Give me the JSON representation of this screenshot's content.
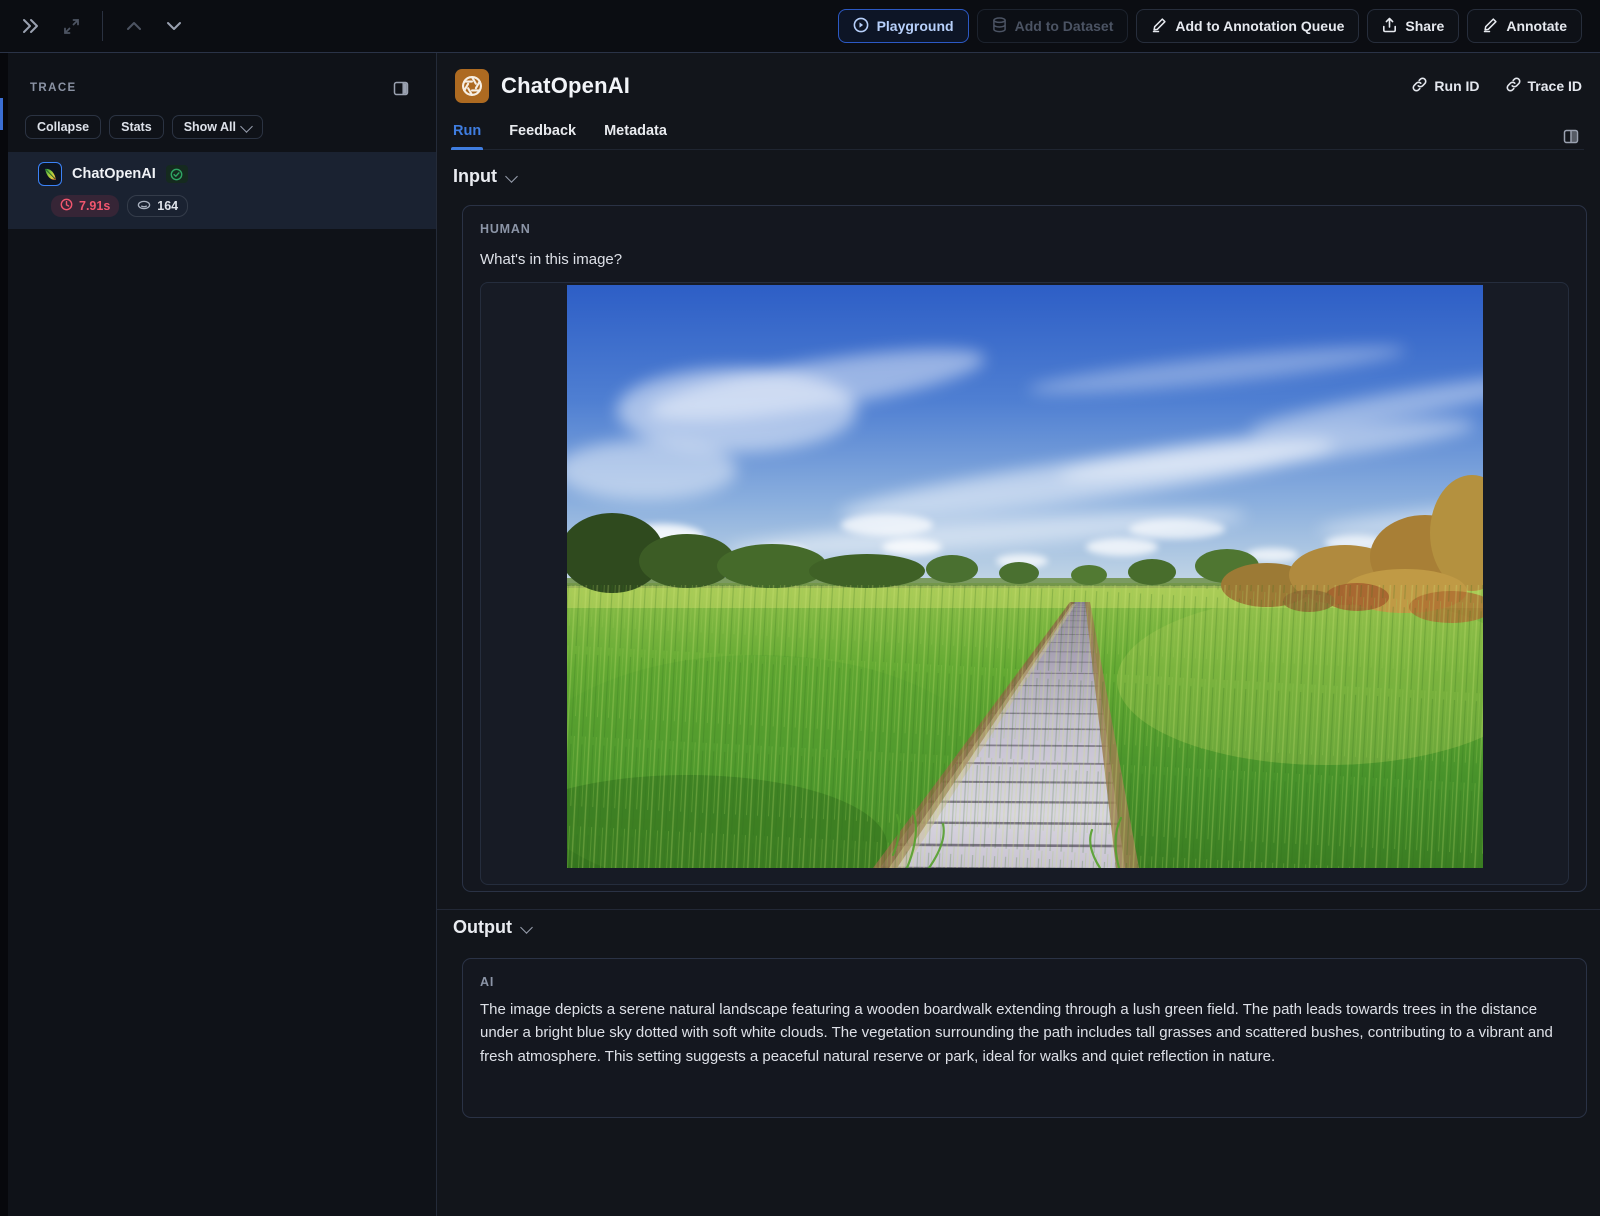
{
  "toolbar": {
    "playground_label": "Playground",
    "add_to_dataset_label": "Add to Dataset",
    "add_to_annotation_queue_label": "Add to Annotation Queue",
    "share_label": "Share",
    "annotate_label": "Annotate"
  },
  "sidebar": {
    "title": "TRACE",
    "collapse_label": "Collapse",
    "stats_label": "Stats",
    "show_all_label": "Show All",
    "trace_item": {
      "name": "ChatOpenAI",
      "status": "success",
      "latency": "7.91s",
      "tokens": "164"
    }
  },
  "header": {
    "title": "ChatOpenAI",
    "run_id_label": "Run ID",
    "trace_id_label": "Trace ID",
    "tabs": [
      {
        "label": "Run",
        "active": true
      },
      {
        "label": "Feedback",
        "active": false
      },
      {
        "label": "Metadata",
        "active": false
      }
    ]
  },
  "input_section": {
    "heading": "Input",
    "role": "HUMAN",
    "message": "What's in this image?",
    "image_alt": "wooden boardwalk through green field under blue sky"
  },
  "output_section": {
    "heading": "Output",
    "role": "AI",
    "message": "The image depicts a serene natural landscape featuring a wooden boardwalk extending through a lush green field. The path leads towards trees in the distance under a bright blue sky dotted with soft white clouds. The vegetation surrounding the path includes tall grasses and scattered bushes, contributing to a vibrant and fresh atmosphere. This setting suggests a peaceful natural reserve or park, ideal for walks and quiet reflection in nature."
  },
  "icons": {
    "collapse-sidebar-icon": "double chevron right »",
    "expand-icon": "four-corner arrows",
    "prev-icon": "chevron up",
    "next-icon": "chevron down",
    "panel-toggle-icon": "split panel rectangle",
    "play-circle-icon": "circle with play triangle",
    "database-icon": "cylinder stack",
    "pen-icon": "pen over line",
    "share-icon": "arrow up from tray",
    "link-icon": "chain link",
    "clock-icon": "clock face",
    "token-icon": "coin ellipse",
    "check-circle-icon": "circled checkmark",
    "parrot-icon": "langchain parrot feather",
    "openai-logo": "openai knot on orange"
  },
  "colors": {
    "accent_blue": "#3f7de0",
    "success_green": "#2fa564",
    "latency_red": "#f2566e",
    "brand_orange": "#ad6a21",
    "selected_row_bg": "#1a2231"
  }
}
